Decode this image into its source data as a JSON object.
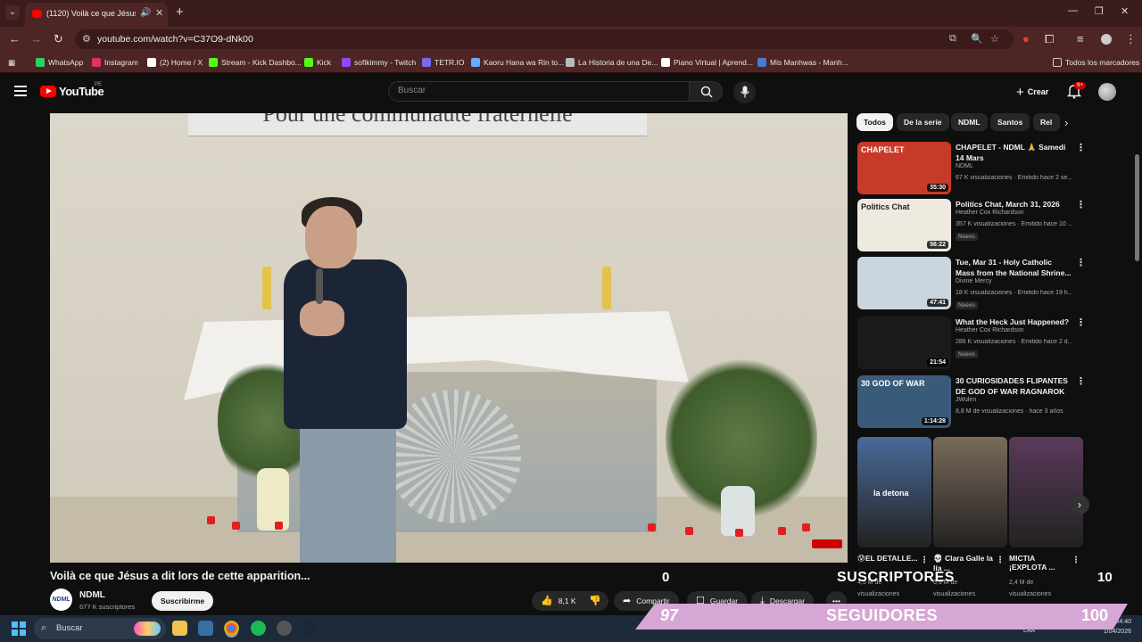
{
  "browser": {
    "tab_title": "(1120) Voilà ce que Jésus a dit",
    "url": "youtube.com/watch?v=C37O9-dNk00",
    "bookmarks": [
      {
        "label": "WhatsApp",
        "color": "#25d366"
      },
      {
        "label": "Instagram",
        "color": "#e1306c"
      },
      {
        "label": "(2) Home / X",
        "color": "#ffffff"
      },
      {
        "label": "Stream - Kick Dashbo...",
        "color": "#53fc18"
      },
      {
        "label": "Kick",
        "color": "#53fc18"
      },
      {
        "label": "sofikimmy - Twitch",
        "color": "#9146ff"
      },
      {
        "label": "TETR.IO",
        "color": "#7b68ee"
      },
      {
        "label": "Kaoru Hana wa Rin to...",
        "color": "#6aa9ff"
      },
      {
        "label": "La Historia de una De...",
        "color": "#bbbbbb"
      },
      {
        "label": "Piano Virtual | Aprend...",
        "color": "#ffffff"
      },
      {
        "label": "Mis Manhwas - Manh...",
        "color": "#4a7bd0"
      }
    ],
    "all_bookmarks": "Todos los marcadores"
  },
  "youtube": {
    "logo_text": "YouTube",
    "country": "PE",
    "search_placeholder": "Buscar",
    "create_label": "Crear",
    "notif_count": "9+"
  },
  "video": {
    "banner_text": "Pour une communauté fraternelle",
    "title": "Voilà ce que Jésus a dit lors de cette apparition...",
    "channel": "NDML",
    "channel_avatar_text": "NDML",
    "subscribers": "677 K suscriptores",
    "subscribe_label": "Suscribirme",
    "likes": "8,1 K",
    "share_label": "Compartir",
    "save_label": "Guardar",
    "download_label": "Descargar"
  },
  "chips": [
    "Todos",
    "De la serie",
    "NDML",
    "Santos",
    "Rel"
  ],
  "recommendations": [
    {
      "title": "CHAPELET - NDML 🙏 Samedi 14 Mars",
      "channel": "NDML",
      "meta": "67 K visualizaciones · Emitido hace 2 se...",
      "duration": "35:30",
      "badge": "",
      "thumb": "#c73a2a",
      "thumb_text": "CHAPELET"
    },
    {
      "title": "Politics Chat, March 31, 2026",
      "channel": "Heather Cox Richardson",
      "meta": "357 K visualizaciones · Emitido hace 10 ...",
      "duration": "56:22",
      "badge": "Nuevo",
      "thumb": "#efeae0",
      "thumb_text": "Politics Chat"
    },
    {
      "title": "Tue, Mar 31 - Holy Catholic Mass from the National Shrine...",
      "channel": "Divine Mercy",
      "meta": "18 K visualizaciones · Emitido hace 19 h...",
      "duration": "47:41",
      "badge": "Nuevo",
      "thumb": "#c9d6df",
      "thumb_text": ""
    },
    {
      "title": "What the Heck Just Happened?",
      "channel": "Heather Cox Richardson",
      "meta": "286 K visualizaciones · Emitido hace 2 d...",
      "duration": "21:54",
      "badge": "Nuevo",
      "thumb": "#1a1a1a",
      "thumb_text": ""
    },
    {
      "title": "30 CURIOSIDADES FLIPANTES DE GOD OF WAR RAGNAROK ...",
      "channel": "JWulen",
      "meta": "8,8 M de visualizaciones · hace 3 años",
      "duration": "1:14:28",
      "badge": "",
      "thumb": "#3a5a7a",
      "thumb_text": "30 GOD OF WAR"
    }
  ],
  "shorts": [
    {
      "title": "😰EL DETALLE...",
      "meta1": "4,5 M de",
      "meta2": "visualizaciones",
      "overlay": "la detona",
      "color": "#4a6a9a"
    },
    {
      "title": "💀 Clara Galle la lía ...",
      "meta1": "6,9 M de",
      "meta2": "visualizaciones",
      "overlay": "",
      "color": "#7a6a5a"
    },
    {
      "title": "MICTIA ¡EXPLOTA ...",
      "meta1": "2,4 M de",
      "meta2": "visualizaciones",
      "overlay": "",
      "color": "#5a3a5a"
    }
  ],
  "overlays": {
    "subs_left": "0",
    "subs_label": "SUSCRIPTORES",
    "subs_right": "10",
    "seg_left": "97",
    "seg_label": "SEGUIDORES",
    "seg_right": "100"
  },
  "taskbar": {
    "search_label": "Buscar",
    "lang": "LAA",
    "time": "04:40",
    "date": "1/04/2026"
  }
}
